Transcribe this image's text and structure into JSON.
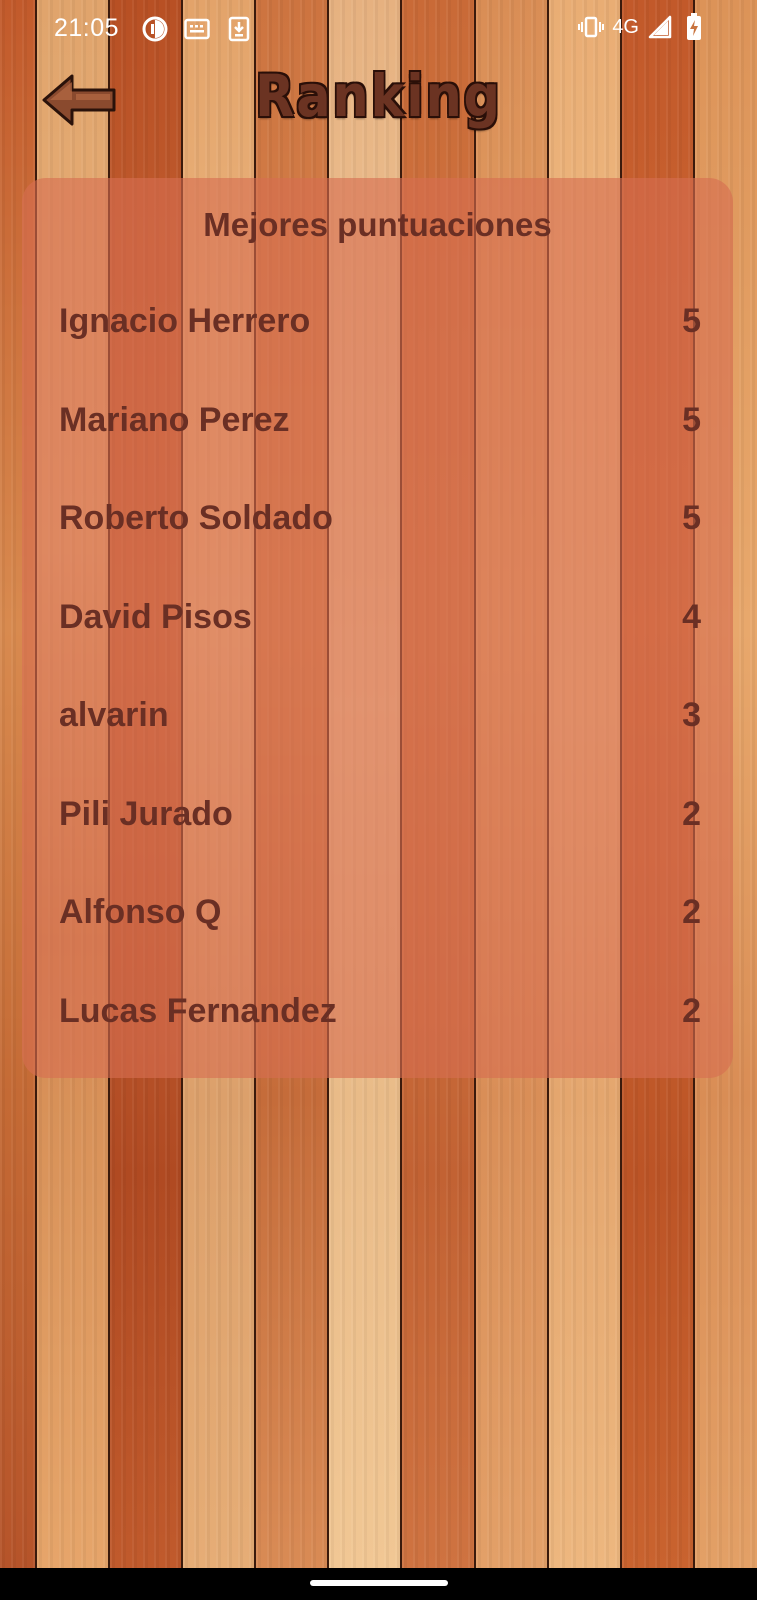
{
  "status_bar": {
    "time": "21:05",
    "network": "4G",
    "icons": [
      "data-saver-icon",
      "keyboard-icon",
      "download-icon",
      "vibrate-icon",
      "signal-icon",
      "battery-charging-icon"
    ]
  },
  "header": {
    "title": "Ranking",
    "back_icon": "arrow-left-icon"
  },
  "panel": {
    "heading": "Mejores puntuaciones",
    "rows": [
      {
        "name": "Ignacio Herrero",
        "score": "5"
      },
      {
        "name": "Mariano Perez",
        "score": "5"
      },
      {
        "name": "Roberto Soldado",
        "score": "5"
      },
      {
        "name": "David Pisos",
        "score": "4"
      },
      {
        "name": "alvarin",
        "score": "3"
      },
      {
        "name": "Pili Jurado",
        "score": "2"
      },
      {
        "name": "Alfonso Q",
        "score": "2"
      },
      {
        "name": "Lucas Fernandez",
        "score": "2"
      }
    ]
  },
  "colors": {
    "text_brown": "#6a2f24",
    "panel_overlay": "#d66e50",
    "title_brown": "#6b3322"
  }
}
